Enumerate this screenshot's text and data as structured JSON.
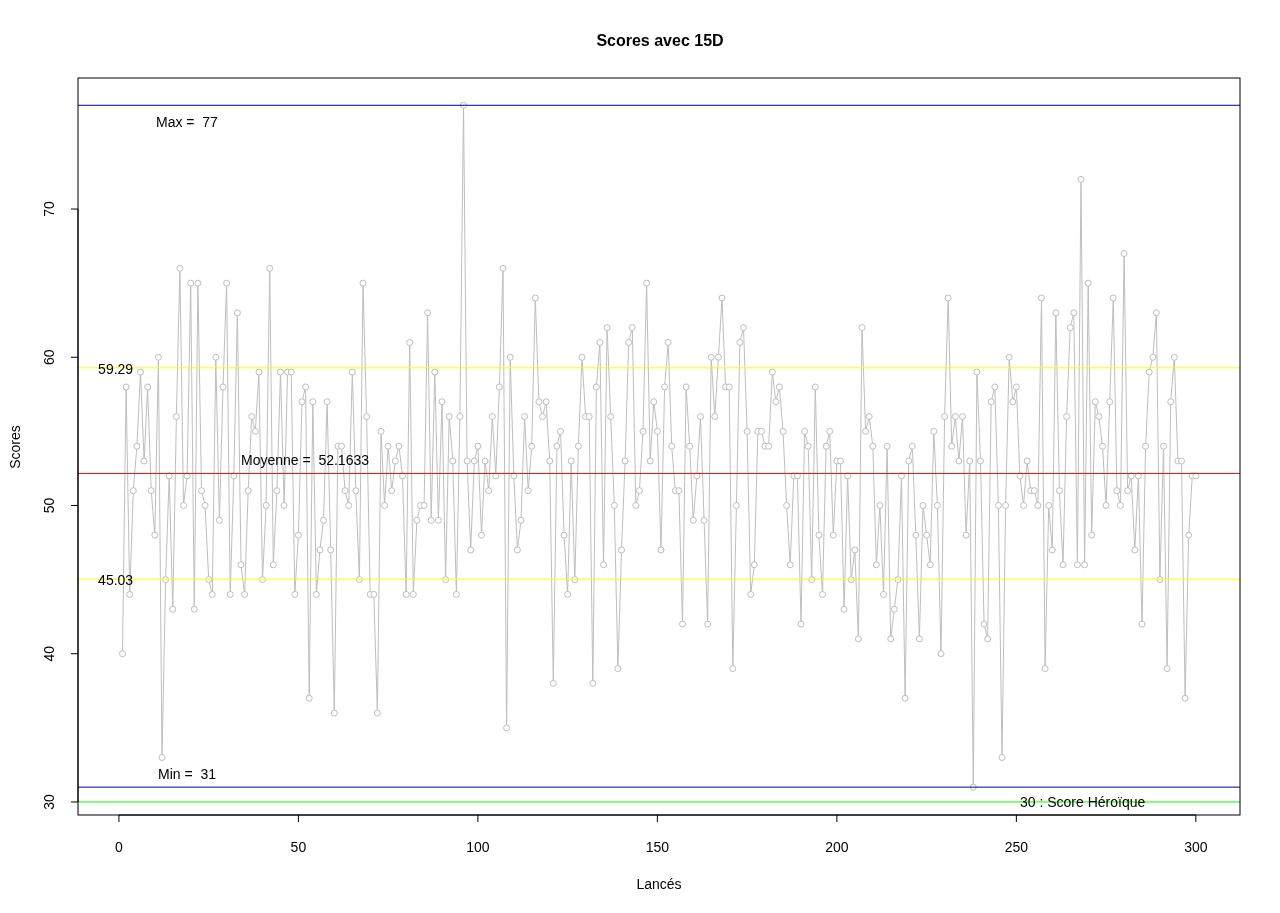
{
  "chart_data": {
    "type": "line",
    "title": "Scores avec 15D",
    "xlabel": "Lancés",
    "ylabel": "Scores",
    "xlim": [
      -11.4,
      312.3
    ],
    "ylim": [
      29.12,
      78.84
    ],
    "xticks": [
      0,
      50,
      100,
      150,
      200,
      250,
      300
    ],
    "yticks": [
      30,
      40,
      50,
      60,
      70
    ],
    "x": [
      1,
      2,
      3,
      4,
      5,
      6,
      7,
      8,
      9,
      10,
      11,
      12,
      13,
      14,
      15,
      16,
      17,
      18,
      19,
      20,
      21,
      22,
      23,
      24,
      25,
      26,
      27,
      28,
      29,
      30,
      31,
      32,
      33,
      34,
      35,
      36,
      37,
      38,
      39,
      40,
      41,
      42,
      43,
      44,
      45,
      46,
      47,
      48,
      49,
      50,
      51,
      52,
      53,
      54,
      55,
      56,
      57,
      58,
      59,
      60,
      61,
      62,
      63,
      64,
      65,
      66,
      67,
      68,
      69,
      70,
      71,
      72,
      73,
      74,
      75,
      76,
      77,
      78,
      79,
      80,
      81,
      82,
      83,
      84,
      85,
      86,
      87,
      88,
      89,
      90,
      91,
      92,
      93,
      94,
      95,
      96,
      97,
      98,
      99,
      100,
      101,
      102,
      103,
      104,
      105,
      106,
      107,
      108,
      109,
      110,
      111,
      112,
      113,
      114,
      115,
      116,
      117,
      118,
      119,
      120,
      121,
      122,
      123,
      124,
      125,
      126,
      127,
      128,
      129,
      130,
      131,
      132,
      133,
      134,
      135,
      136,
      137,
      138,
      139,
      140,
      141,
      142,
      143,
      144,
      145,
      146,
      147,
      148,
      149,
      150,
      151,
      152,
      153,
      154,
      155,
      156,
      157,
      158,
      159,
      160,
      161,
      162,
      163,
      164,
      165,
      166,
      167,
      168,
      169,
      170,
      171,
      172,
      173,
      174,
      175,
      176,
      177,
      178,
      179,
      180,
      181,
      182,
      183,
      184,
      185,
      186,
      187,
      188,
      189,
      190,
      191,
      192,
      193,
      194,
      195,
      196,
      197,
      198,
      199,
      200,
      201,
      202,
      203,
      204,
      205,
      206,
      207,
      208,
      209,
      210,
      211,
      212,
      213,
      214,
      215,
      216,
      217,
      218,
      219,
      220,
      221,
      222,
      223,
      224,
      225,
      226,
      227,
      228,
      229,
      230,
      231,
      232,
      233,
      234,
      235,
      236,
      237,
      238,
      239,
      240,
      241,
      242,
      243,
      244,
      245,
      246,
      247,
      248,
      249,
      250,
      251,
      252,
      253,
      254,
      255,
      256,
      257,
      258,
      259,
      260,
      261,
      262,
      263,
      264,
      265,
      266,
      267,
      268,
      269,
      270,
      271,
      272,
      273,
      274,
      275,
      276,
      277,
      278,
      279,
      280,
      281,
      282,
      283,
      284,
      285,
      286,
      287,
      288,
      289,
      290,
      291,
      292,
      293,
      294,
      295,
      296,
      297,
      298,
      299,
      300
    ],
    "series": [
      {
        "color": "#bebebe",
        "marker": "circle",
        "values": [
          40,
          58,
          44,
          51,
          54,
          59,
          53,
          58,
          51,
          48,
          60,
          33,
          45,
          52,
          43,
          56,
          66,
          50,
          52,
          65,
          43,
          65,
          51,
          50,
          45,
          44,
          60,
          49,
          58,
          65,
          44,
          52,
          63,
          46,
          44,
          51,
          56,
          55,
          59,
          45,
          50,
          66,
          46,
          51,
          59,
          50,
          59,
          59,
          44,
          48,
          57,
          58,
          37,
          57,
          44,
          47,
          49,
          57,
          47,
          36,
          54,
          54,
          51,
          50,
          59,
          51,
          45,
          65,
          56,
          44,
          44,
          36,
          55,
          50,
          54,
          51,
          53,
          54,
          52,
          44,
          61,
          44,
          49,
          50,
          50,
          63,
          49,
          59,
          49,
          57,
          45,
          56,
          53,
          44,
          56,
          77,
          53,
          47,
          53,
          54,
          48,
          53,
          51,
          56,
          52,
          58,
          66,
          35,
          60,
          52,
          47,
          49,
          56,
          51,
          54,
          64,
          57,
          56,
          57,
          53,
          38,
          54,
          55,
          48,
          44,
          53,
          45,
          54,
          60,
          56,
          56,
          38,
          58,
          61,
          46,
          62,
          56,
          50,
          39,
          47,
          53,
          61,
          62,
          50,
          51,
          55,
          65,
          53,
          57,
          55,
          47,
          58,
          61,
          54,
          51,
          51,
          42,
          58,
          54,
          49,
          52,
          56,
          49,
          42,
          60,
          56,
          60,
          64,
          58,
          58,
          39,
          50,
          61,
          62,
          55,
          44,
          46,
          55,
          55,
          54,
          54,
          59,
          57,
          58,
          55,
          50,
          46,
          52,
          52,
          42,
          55,
          54,
          45,
          58,
          48,
          44,
          54,
          55,
          48,
          53,
          53,
          43,
          52,
          45,
          47,
          41,
          62,
          55,
          56,
          54,
          46,
          50,
          44,
          54,
          41,
          43,
          45,
          52,
          37,
          53,
          54,
          48,
          41,
          50,
          48,
          46,
          55,
          50,
          40,
          56,
          64,
          54,
          56,
          53,
          56,
          48,
          53,
          31,
          59,
          53,
          42,
          41,
          57,
          58,
          50,
          33,
          50,
          60,
          57,
          58,
          52,
          50,
          53,
          51,
          51,
          50,
          64,
          39,
          50,
          47,
          63,
          51,
          46,
          56,
          62,
          63,
          46,
          72,
          46,
          65,
          48,
          57,
          56,
          54,
          50,
          57,
          64,
          51,
          50,
          67,
          51,
          52,
          47,
          52,
          42,
          54,
          59,
          60,
          63,
          45,
          54,
          39,
          57,
          60,
          53,
          53,
          37,
          48,
          52,
          52
        ]
      }
    ],
    "ref_lines": [
      {
        "axis": "y",
        "value": 77,
        "color": "#00008b"
      },
      {
        "axis": "y",
        "value": 31,
        "color": "#00008b"
      },
      {
        "axis": "y",
        "value": 52.1633,
        "color": "#ff0000"
      },
      {
        "axis": "y",
        "value": 59.29,
        "color": "#ffff00"
      },
      {
        "axis": "y",
        "value": 45.03,
        "color": "#ffff00"
      },
      {
        "axis": "y",
        "value": 30,
        "color": "#00ff00"
      }
    ],
    "annotations": [
      "Max =  77",
      "Min =  31",
      {
        "text": "Moyenne =  52.1633",
        "x": 34,
        "y": 53.1
      },
      {
        "text": "59.29",
        "x": -5.8,
        "y": 59.2
      },
      {
        "text": "45.03",
        "x": -5.8,
        "y": 45.0
      },
      {
        "text": "30 : Score Héroïque",
        "x": 251,
        "y": 30.0
      }
    ]
  }
}
